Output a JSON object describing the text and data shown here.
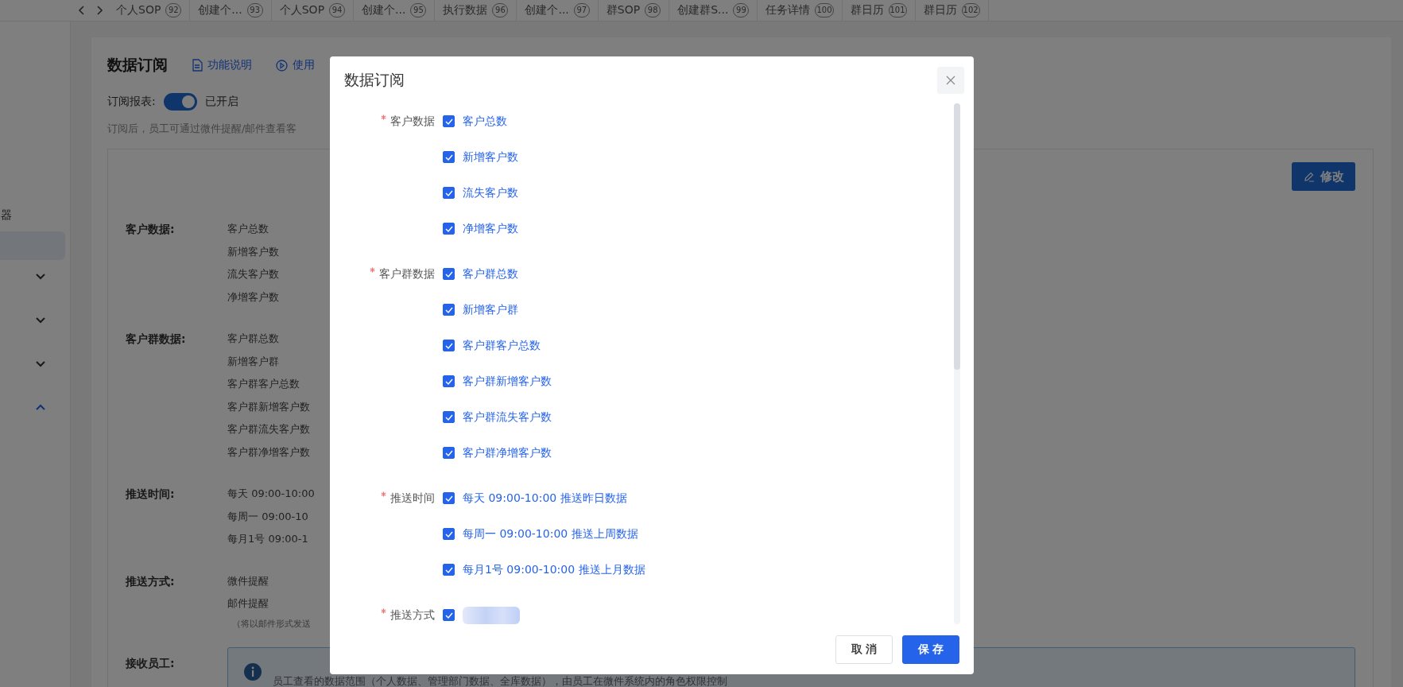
{
  "tab_bar": {
    "tabs": [
      {
        "label": "个人SOP",
        "badge": "92",
        "selected": false
      },
      {
        "label": "创建个...",
        "badge": "93",
        "selected": false
      },
      {
        "label": "个人SOP",
        "badge": "94",
        "selected": false
      },
      {
        "label": "创建个...",
        "badge": "95",
        "selected": false
      },
      {
        "label": "执行数据",
        "badge": "96",
        "selected": false
      },
      {
        "label": "创建个...",
        "badge": "97",
        "selected": false
      },
      {
        "label": "群SOP",
        "badge": "98",
        "selected": false
      },
      {
        "label": "创建群S...",
        "badge": "99",
        "selected": false
      },
      {
        "label": "任务详情",
        "badge": "100",
        "selected": false
      },
      {
        "label": "群日历",
        "badge": "101",
        "selected": false
      },
      {
        "label": "群日历",
        "badge": "102",
        "selected": false
      }
    ]
  },
  "sidebar": {
    "items": [
      {
        "kind": "text",
        "label": "器"
      },
      {
        "kind": "highlight",
        "selected": true
      },
      {
        "kind": "group",
        "expanded": false
      },
      {
        "kind": "group",
        "expanded": false
      },
      {
        "kind": "group",
        "expanded": false
      },
      {
        "kind": "group",
        "expanded": true
      }
    ]
  },
  "page": {
    "title": "数据订阅",
    "links": [
      {
        "kind": "doc",
        "label": "功能说明"
      },
      {
        "kind": "play",
        "label": "使用"
      }
    ],
    "subscribe": {
      "label": "订阅报表:",
      "on": true,
      "status": "已开启"
    },
    "hint": "订阅后，员工可通过微件提醒/邮件查看客",
    "edit_button": "修改",
    "sections": [
      {
        "label": "客户数据:",
        "items": [
          "客户总数",
          "新增客户数",
          "流失客户数",
          "净增客户数"
        ]
      },
      {
        "label": "客户群数据:",
        "items": [
          "客户群总数",
          "新增客户群",
          "客户群客户总数",
          "客户群新增客户数",
          "客户群流失客户数",
          "客户群净增客户数"
        ]
      },
      {
        "label": "推送时间:",
        "items": [
          "每天 09:00-10:00",
          "每周一 09:00-10",
          "每月1号 09:00-1"
        ]
      },
      {
        "label": "推送方式:",
        "items": [
          "微件提醒",
          "邮件提醒"
        ],
        "note": "（将以邮件形式发送"
      }
    ],
    "recipients": {
      "label": "接收员工:",
      "info": "员工查看的数据范围（个人数据、管理部门数据、全库数据），由员工在微件系统内的角色权限控制"
    }
  },
  "dialog": {
    "title": "数据订阅",
    "groups": [
      {
        "label": "客户数据",
        "required": true,
        "options": [
          {
            "label": "客户总数",
            "checked": true
          },
          {
            "label": "新增客户数",
            "checked": true
          },
          {
            "label": "流失客户数",
            "checked": true
          },
          {
            "label": "净增客户数",
            "checked": true
          }
        ]
      },
      {
        "label": "客户群数据",
        "required": true,
        "options": [
          {
            "label": "客户群总数",
            "checked": true
          },
          {
            "label": "新增客户群",
            "checked": true
          },
          {
            "label": "客户群客户总数",
            "checked": true
          },
          {
            "label": "客户群新增客户数",
            "checked": true
          },
          {
            "label": "客户群流失客户数",
            "checked": true
          },
          {
            "label": "客户群净增客户数",
            "checked": true
          }
        ]
      },
      {
        "label": "推送时间",
        "required": true,
        "options": [
          {
            "label": "每天 09:00-10:00 推送昨日数据",
            "checked": true
          },
          {
            "label": "每周一 09:00-10:00 推送上周数据",
            "checked": true
          },
          {
            "label": "每月1号 09:00-10:00 推送上月数据",
            "checked": true
          }
        ]
      },
      {
        "label": "推送方式",
        "required": true,
        "options": [
          {
            "redacted": true,
            "checked": true
          }
        ]
      }
    ],
    "buttons": [
      {
        "label": "取 消",
        "kind": "default"
      },
      {
        "label": "保 存",
        "kind": "primary"
      }
    ]
  }
}
